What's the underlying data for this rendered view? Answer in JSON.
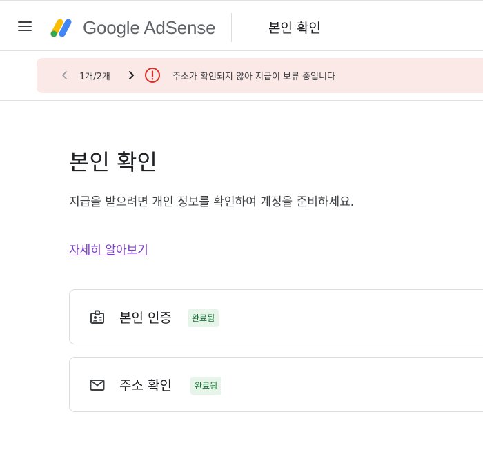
{
  "header": {
    "brand": "Google AdSense",
    "title": "본인 확인",
    "logo_colors": [
      "#fbbc04",
      "#4285f4",
      "#34a853"
    ]
  },
  "alert": {
    "count": "1개/2개",
    "message": "주소가 확인되지 않아 지급이 보류 중입니다",
    "icon": "error-icon",
    "icon_color": "#d93025",
    "background": "#fbe9e7"
  },
  "main": {
    "title": "본인 확인",
    "description": "지급을 받으려면 개인 정보를 확인하여 계정을 준비하세요.",
    "learn_more": "자세히 알아보기"
  },
  "items": [
    {
      "label": "본인 인증",
      "status": "완료됨",
      "icon": "id-badge-icon"
    },
    {
      "label": "주소 확인",
      "status": "완료됨",
      "icon": "mail-icon"
    }
  ]
}
